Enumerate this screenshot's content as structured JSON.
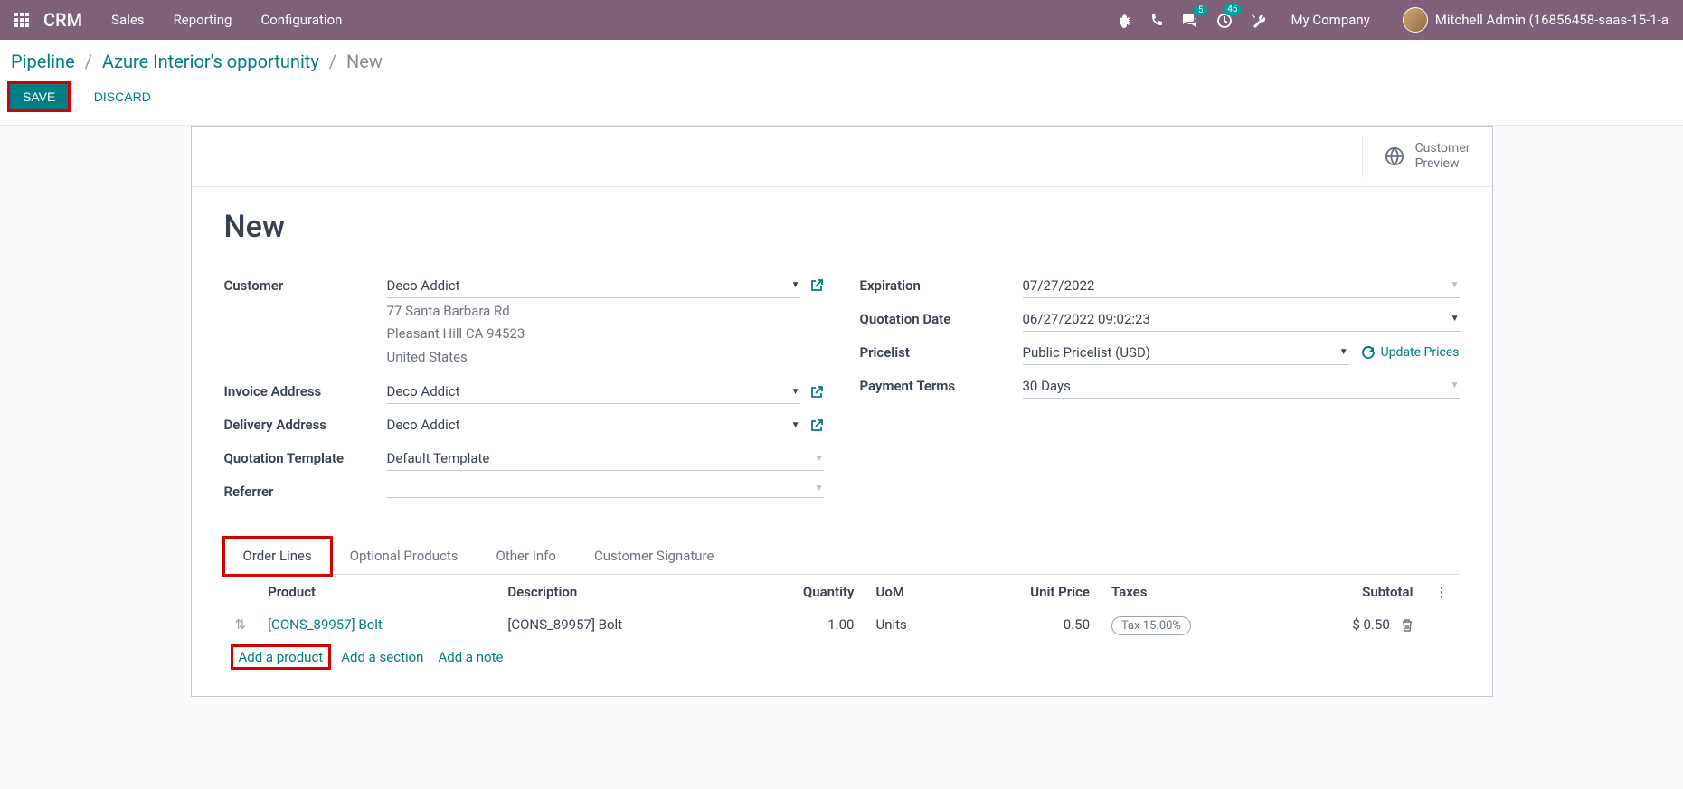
{
  "nav": {
    "brand": "CRM",
    "items": [
      "Sales",
      "Reporting",
      "Configuration"
    ],
    "chat_badge": "5",
    "activity_badge": "45",
    "company": "My Company",
    "user": "Mitchell Admin (16856458-saas-15-1-a"
  },
  "breadcrumb": {
    "root": "Pipeline",
    "parent": "Azure Interior's opportunity",
    "current": "New"
  },
  "actions": {
    "save": "SAVE",
    "discard": "DISCARD"
  },
  "sheet": {
    "customer_preview": "Customer Preview",
    "title": "New",
    "left_fields": {
      "customer_label": "Customer",
      "customer_value": "Deco Addict",
      "address_line1": "77 Santa Barbara Rd",
      "address_line2": "Pleasant Hill CA 94523",
      "address_line3": "United States",
      "invoice_label": "Invoice Address",
      "invoice_value": "Deco Addict",
      "delivery_label": "Delivery Address",
      "delivery_value": "Deco Addict",
      "template_label": "Quotation Template",
      "template_value": "Default Template",
      "referrer_label": "Referrer",
      "referrer_value": ""
    },
    "right_fields": {
      "expiration_label": "Expiration",
      "expiration_value": "07/27/2022",
      "quotation_date_label": "Quotation Date",
      "quotation_date_value": "06/27/2022 09:02:23",
      "pricelist_label": "Pricelist",
      "pricelist_value": "Public Pricelist (USD)",
      "update_prices": "Update Prices",
      "payment_terms_label": "Payment Terms",
      "payment_terms_value": "30 Days"
    },
    "tabs": [
      "Order Lines",
      "Optional Products",
      "Other Info",
      "Customer Signature"
    ],
    "columns": {
      "product": "Product",
      "description": "Description",
      "quantity": "Quantity",
      "uom": "UoM",
      "unit_price": "Unit Price",
      "taxes": "Taxes",
      "subtotal": "Subtotal"
    },
    "lines": [
      {
        "product": "[CONS_89957] Bolt",
        "description": "[CONS_89957] Bolt",
        "quantity": "1.00",
        "uom": "Units",
        "unit_price": "0.50",
        "taxes": "Tax 15.00%",
        "subtotal": "$ 0.50"
      }
    ],
    "line_actions": {
      "add_product": "Add a product",
      "add_section": "Add a section",
      "add_note": "Add a note"
    }
  }
}
